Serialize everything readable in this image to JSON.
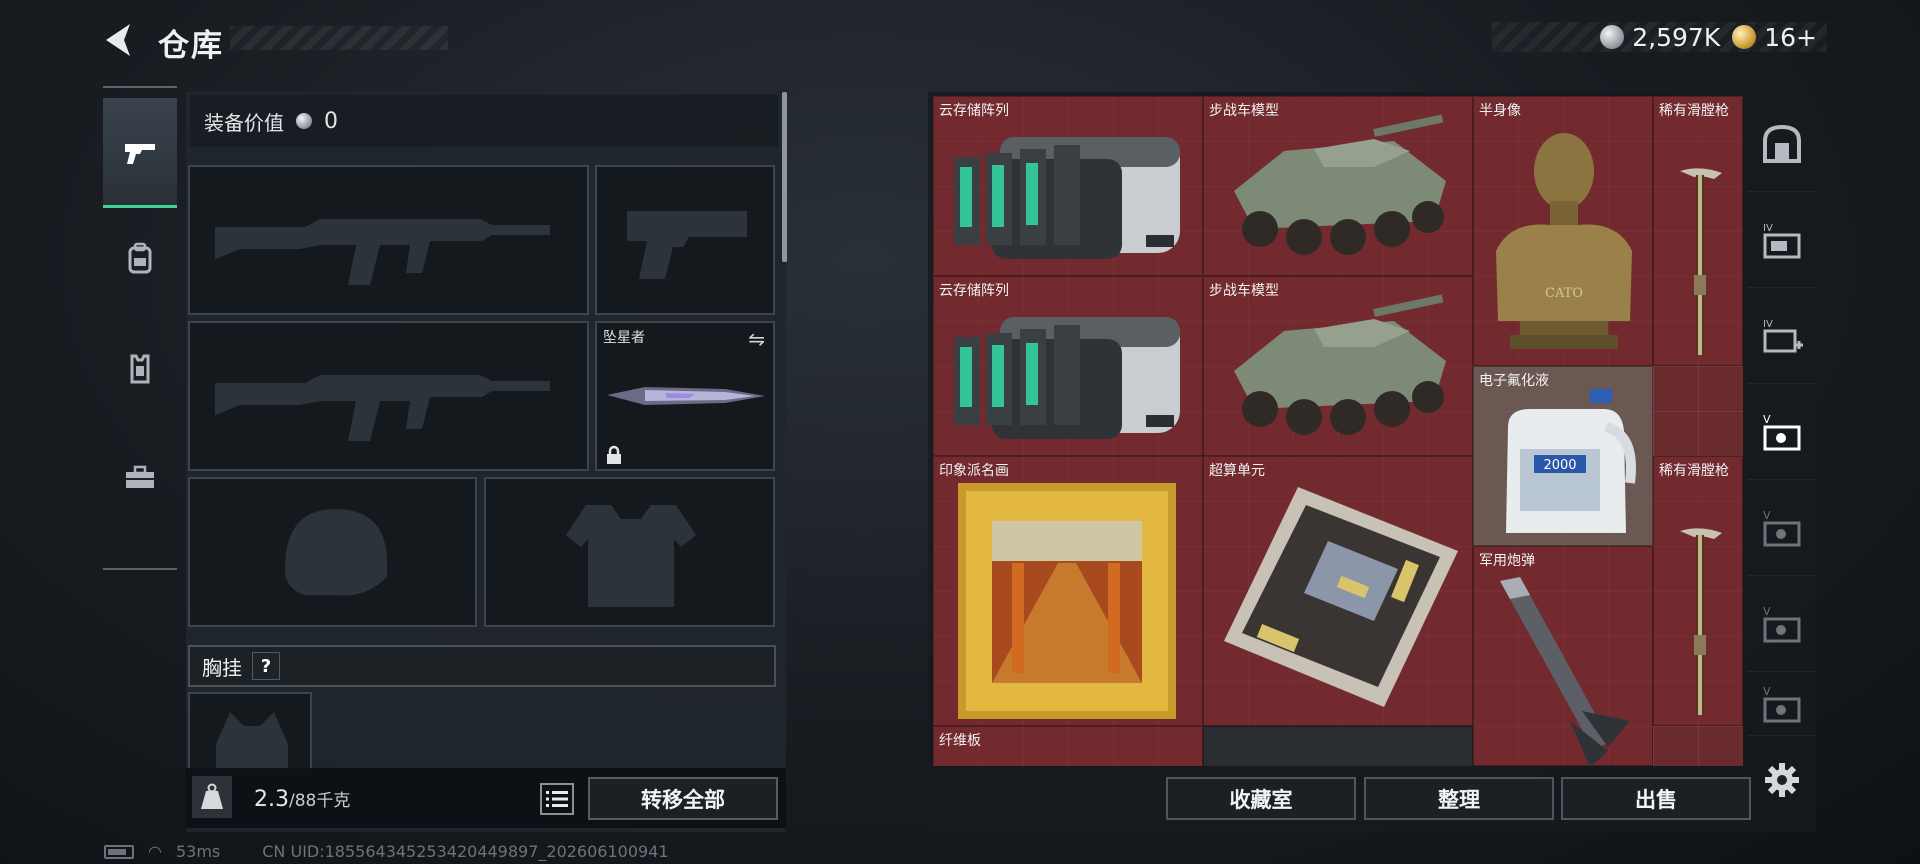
{
  "header": {
    "title": "仓库",
    "currencies": [
      {
        "icon": "silver-coin-icon",
        "value": "2,597K"
      },
      {
        "icon": "gold-coin-icon",
        "value": "16+"
      }
    ]
  },
  "category_tabs": [
    {
      "icon": "pistol-icon",
      "active": true
    },
    {
      "icon": "backpack-icon",
      "active": false
    },
    {
      "icon": "armor-vest-icon",
      "active": false
    },
    {
      "icon": "toolbox-icon",
      "active": false
    }
  ],
  "equipment": {
    "value_label": "装备价值",
    "value": "0",
    "slots": [
      {
        "id": "primary-weapon-1",
        "label": ""
      },
      {
        "id": "pistol",
        "label": ""
      },
      {
        "id": "primary-weapon-2",
        "label": ""
      },
      {
        "id": "melee",
        "label": "坠星者"
      },
      {
        "id": "helmet",
        "label": ""
      },
      {
        "id": "body-armor",
        "label": ""
      }
    ],
    "chest_rig_label": "胸挂",
    "chest_rig_help": "?",
    "weight_value": "2.3",
    "weight_max": "/88千克",
    "transfer_all": "转移全部"
  },
  "storage": {
    "items": [
      {
        "name": "云存储阵列"
      },
      {
        "name": "步战车模型"
      },
      {
        "name": "半身像"
      },
      {
        "name": "稀有滑膛枪"
      },
      {
        "name": "云存储阵列"
      },
      {
        "name": "步战车模型"
      },
      {
        "name": "电子氟化液"
      },
      {
        "name": "印象派名画"
      },
      {
        "name": "超算单元"
      },
      {
        "name": "稀有滑膛枪"
      },
      {
        "name": "军用炮弹"
      },
      {
        "name": "纤维板"
      }
    ],
    "bust_inscription": "CATO",
    "bottle_label": "2000",
    "filter_tabs": [
      {
        "icon": "vault-icon"
      },
      {
        "icon": "container-iv-icon"
      },
      {
        "icon": "container-iv-add-icon"
      },
      {
        "icon": "container-v-icon"
      },
      {
        "icon": "container-v-icon"
      },
      {
        "icon": "container-v-icon"
      },
      {
        "icon": "container-v-icon"
      }
    ],
    "buttons": {
      "collection": "收藏室",
      "sort": "整理",
      "sell": "出售"
    }
  },
  "status": {
    "ping": "53ms",
    "uid": "CN UID:185564345253420449897_202606100941"
  }
}
